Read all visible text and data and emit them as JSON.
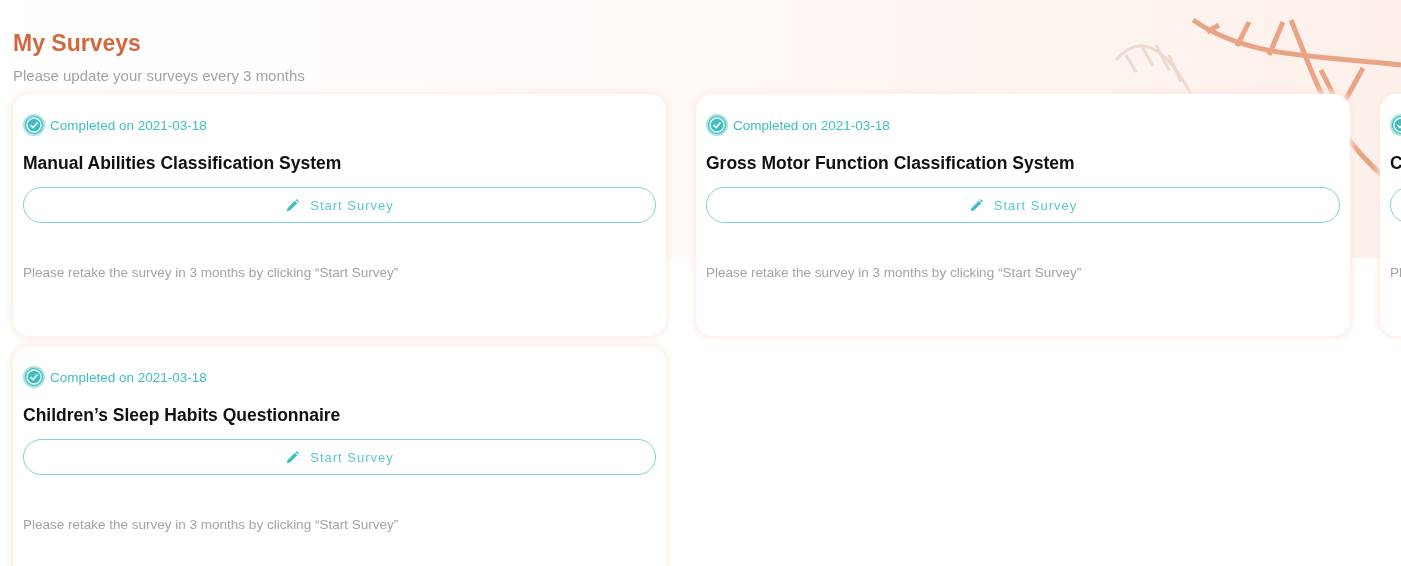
{
  "header": {
    "title": "My Surveys",
    "subtitle": "Please update your surveys every 3 months"
  },
  "surveys": [
    {
      "completed": true,
      "status": "Completed on 2021-03-18",
      "title": "Manual Abilities Classification System",
      "button": "Start Survey",
      "note": "Please retake the survey in 3 months by clicking “Start Survey”"
    },
    {
      "completed": true,
      "status": "Completed on 2021-03-18",
      "title": "Gross Motor Function Classification System",
      "button": "Start Survey",
      "note": "Please retake the survey in 3 months by clicking “Start Survey”"
    },
    {
      "completed": true,
      "title": "C",
      "note": "Pl"
    },
    {
      "completed": true,
      "status": "Completed on 2021-03-18",
      "title": "Children’s Sleep Habits Questionnaire",
      "button": "Start Survey",
      "note": "Please retake the survey in 3 months by clicking “Start Survey”"
    }
  ]
}
